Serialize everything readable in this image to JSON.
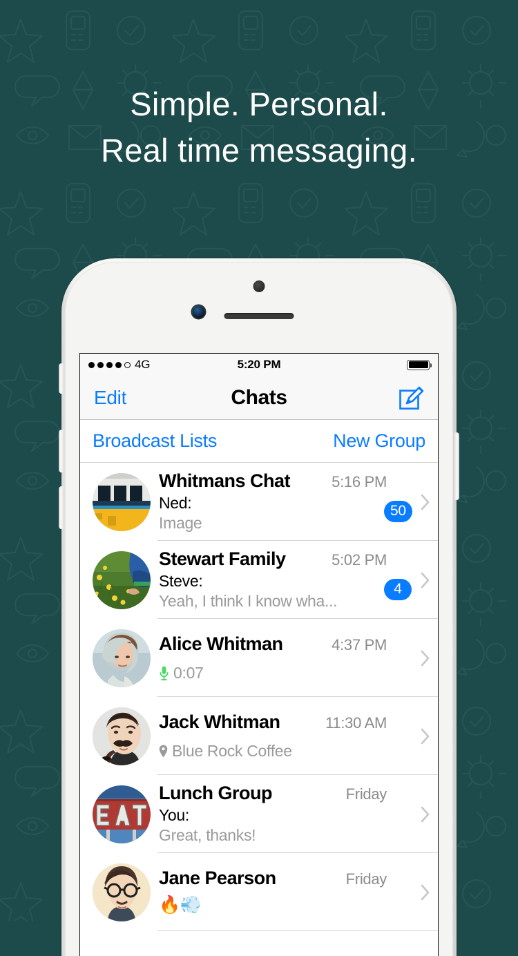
{
  "promo": {
    "line1": "Simple. Personal.",
    "line2": "Real time messaging.",
    "bg_color": "#1d4a4a",
    "text_color": "#ffffff"
  },
  "device": {
    "frame_color": "#f4f4f2",
    "camera_icon": "camera-dot",
    "sensor_icon": "proximity-sensor",
    "speaker_icon": "earpiece-speaker"
  },
  "status_bar": {
    "signal_dots_filled": 4,
    "signal_dots_total": 5,
    "carrier": "4G",
    "time": "5:20 PM",
    "battery_icon": "battery-full",
    "battery_level": 100
  },
  "nav_bar": {
    "left_button": "Edit",
    "title": "Chats",
    "right_icon": "compose-icon",
    "accent_color": "#0a7cff"
  },
  "sub_bar": {
    "broadcast_label": "Broadcast Lists",
    "new_group_label": "New Group"
  },
  "chats": [
    {
      "avatar": "tram-photo",
      "name": "Whitmans Chat",
      "time": "5:16 PM",
      "sender": "Ned:",
      "preview": "Image",
      "preview_icon": "",
      "badge": "50",
      "chevron": "chevron-right-icon"
    },
    {
      "avatar": "meadow-photo",
      "name": "Stewart Family",
      "time": "5:02 PM",
      "sender": "Steve:",
      "preview": "Yeah, I think I know wha...",
      "preview_icon": "",
      "badge": "4",
      "chevron": "chevron-right-icon"
    },
    {
      "avatar": "woman-hoodie-photo",
      "name": "Alice Whitman",
      "time": "4:37 PM",
      "sender": "",
      "preview": "0:07",
      "preview_icon": "microphone-icon",
      "badge": "",
      "chevron": "chevron-right-icon"
    },
    {
      "avatar": "man-pipe-photo",
      "name": "Jack Whitman",
      "time": "11:30 AM",
      "sender": "",
      "preview": "Blue Rock Coffee",
      "preview_icon": "location-pin-icon",
      "badge": "",
      "chevron": "chevron-right-icon"
    },
    {
      "avatar": "eat-sign-photo",
      "name": "Lunch Group",
      "time": "Friday",
      "sender": "You:",
      "preview": "Great, thanks!",
      "preview_icon": "",
      "badge": "",
      "chevron": "chevron-right-icon"
    },
    {
      "avatar": "man-glasses-photo",
      "name": "Jane Pearson",
      "time": "Friday",
      "sender": "",
      "preview": "🔥💨",
      "preview_icon": "",
      "badge": "",
      "chevron": "chevron-right-icon"
    }
  ],
  "colors": {
    "accent_blue": "#0a7cff",
    "badge_blue": "#0a7cff",
    "mic_green": "#4cd964",
    "secondary_text": "#9a9a9a",
    "time_text": "#8b8b8b"
  }
}
